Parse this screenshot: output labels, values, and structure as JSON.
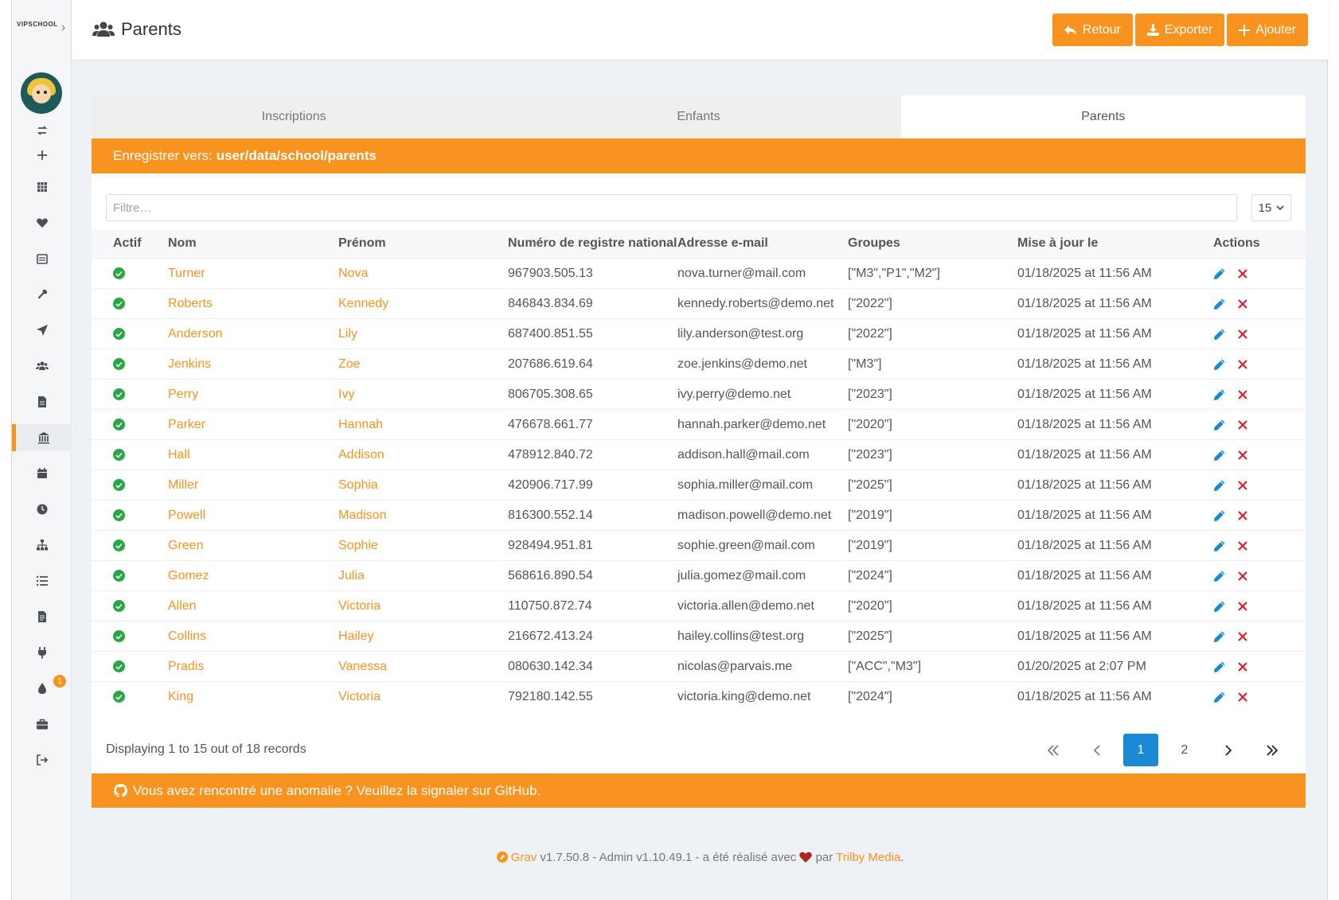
{
  "sidebar": {
    "logo": "VIPSCHOOL",
    "icons": [
      "sync-icon",
      "plus-icon",
      "grid-icon",
      "heart-icon",
      "calendar-list-icon",
      "wrench-icon",
      "send-icon",
      "users-icon",
      "file-icon",
      "bank-icon",
      "calendar-icon",
      "clock-icon",
      "sitemap-icon",
      "list-icon",
      "file-alt-icon",
      "plug-icon",
      "tint-icon",
      "briefcase-icon",
      "logout-icon"
    ],
    "badge": "1"
  },
  "header": {
    "title": "Parents",
    "back_label": "Retour",
    "export_label": "Exporter",
    "add_label": "Ajouter"
  },
  "tabs": [
    {
      "label": "Inscriptions"
    },
    {
      "label": "Enfants"
    },
    {
      "label": "Parents"
    }
  ],
  "save": {
    "prefix": "Enregistrer vers:",
    "path": "user/data/school/parents"
  },
  "filter": {
    "placeholder": "Filtre…",
    "per_page": "15"
  },
  "table": {
    "headers": [
      "Actif",
      "Nom",
      "Prénom",
      "Numéro de registre national",
      "Adresse e-mail",
      "Groupes",
      "Mise à jour le",
      "Actions"
    ],
    "rows": [
      {
        "nom": "Turner",
        "prenom": "Nova",
        "nrn": "967903.505.13",
        "email": "nova.turner@mail.com",
        "groupes": "[\"M3\",\"P1\",\"M2\"]",
        "maj": "01/18/2025 at 11:56 AM"
      },
      {
        "nom": "Roberts",
        "prenom": "Kennedy",
        "nrn": "846843.834.69",
        "email": "kennedy.roberts@demo.net",
        "groupes": "[\"2022\"]",
        "maj": "01/18/2025 at 11:56 AM"
      },
      {
        "nom": "Anderson",
        "prenom": "Lily",
        "nrn": "687400.851.55",
        "email": "lily.anderson@test.org",
        "groupes": "[\"2022\"]",
        "maj": "01/18/2025 at 11:56 AM"
      },
      {
        "nom": "Jenkins",
        "prenom": "Zoe",
        "nrn": "207686.619.64",
        "email": "zoe.jenkins@demo.net",
        "groupes": "[\"M3\"]",
        "maj": "01/18/2025 at 11:56 AM"
      },
      {
        "nom": "Perry",
        "prenom": "Ivy",
        "nrn": "806705.308.65",
        "email": "ivy.perry@demo.net",
        "groupes": "[\"2023\"]",
        "maj": "01/18/2025 at 11:56 AM"
      },
      {
        "nom": "Parker",
        "prenom": "Hannah",
        "nrn": "476678.661.77",
        "email": "hannah.parker@demo.net",
        "groupes": "[\"2020\"]",
        "maj": "01/18/2025 at 11:56 AM"
      },
      {
        "nom": "Hall",
        "prenom": "Addison",
        "nrn": "478912.840.72",
        "email": "addison.hall@mail.com",
        "groupes": "[\"2023\"]",
        "maj": "01/18/2025 at 11:56 AM"
      },
      {
        "nom": "Miller",
        "prenom": "Sophia",
        "nrn": "420906.717.99",
        "email": "sophia.miller@mail.com",
        "groupes": "[\"2025\"]",
        "maj": "01/18/2025 at 11:56 AM"
      },
      {
        "nom": "Powell",
        "prenom": "Madison",
        "nrn": "816300.552.14",
        "email": "madison.powell@demo.net",
        "groupes": "[\"2019\"]",
        "maj": "01/18/2025 at 11:56 AM"
      },
      {
        "nom": "Green",
        "prenom": "Sophie",
        "nrn": "928494.951.81",
        "email": "sophie.green@mail.com",
        "groupes": "[\"2019\"]",
        "maj": "01/18/2025 at 11:56 AM"
      },
      {
        "nom": "Gomez",
        "prenom": "Julia",
        "nrn": "568616.890.54",
        "email": "julia.gomez@mail.com",
        "groupes": "[\"2024\"]",
        "maj": "01/18/2025 at 11:56 AM"
      },
      {
        "nom": "Allen",
        "prenom": "Victoria",
        "nrn": "110750.872.74",
        "email": "victoria.allen@demo.net",
        "groupes": "[\"2020\"]",
        "maj": "01/18/2025 at 11:56 AM"
      },
      {
        "nom": "Collins",
        "prenom": "Hailey",
        "nrn": "216672.413.24",
        "email": "hailey.collins@test.org",
        "groupes": "[\"2025\"]",
        "maj": "01/18/2025 at 11:56 AM"
      },
      {
        "nom": "Pradis",
        "prenom": "Vanessa",
        "nrn": "080630.142.34",
        "email": "nicolas@parvais.me",
        "groupes": "[\"ACC\",\"M3\"]",
        "maj": "01/20/2025 at 2:07 PM"
      },
      {
        "nom": "King",
        "prenom": "Victoria",
        "nrn": "792180.142.55",
        "email": "victoria.king@demo.net",
        "groupes": "[\"2024\"]",
        "maj": "01/18/2025 at 11:56 AM"
      }
    ]
  },
  "footer": {
    "records": "Displaying 1 to 15 out of 18 records",
    "pages": [
      "1",
      "2"
    ],
    "github": "Vous avez rencontré une anomalie ? Veuillez la signaler sur GitHub."
  },
  "credit": {
    "grav": "Grav",
    "mid": "v1.7.50.8 - Admin v1.10.49.1 - a été réalisé avec",
    "par": "par",
    "trilby": "Trilby Media",
    "end": "."
  },
  "colors": {
    "accent": "#f7931e",
    "active_page": "#1a8ad4",
    "ok": "#28a745",
    "edit": "#1a8ad4",
    "delete": "#e0202a"
  }
}
